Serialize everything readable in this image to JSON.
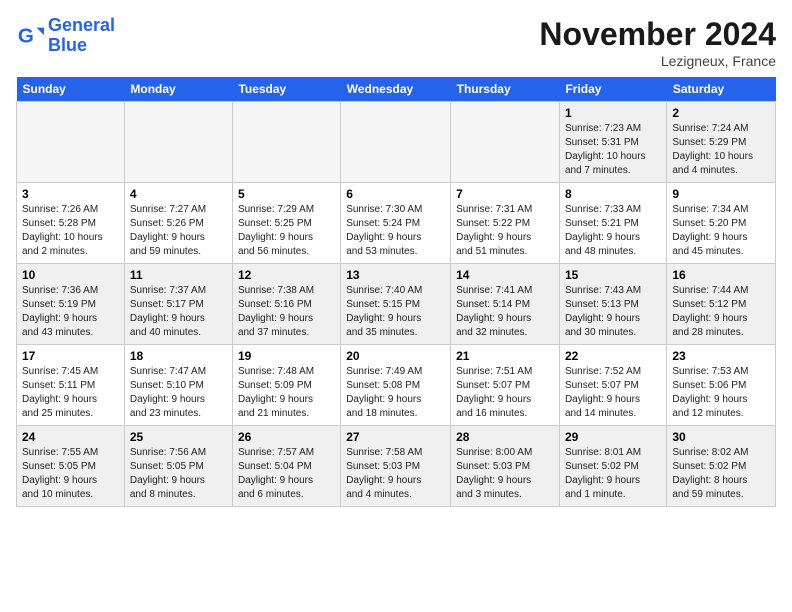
{
  "logo": {
    "line1": "General",
    "line2": "Blue"
  },
  "title": "November 2024",
  "location": "Lezigneux, France",
  "days_of_week": [
    "Sunday",
    "Monday",
    "Tuesday",
    "Wednesday",
    "Thursday",
    "Friday",
    "Saturday"
  ],
  "rows": [
    [
      {
        "num": "",
        "info": "",
        "empty": true
      },
      {
        "num": "",
        "info": "",
        "empty": true
      },
      {
        "num": "",
        "info": "",
        "empty": true
      },
      {
        "num": "",
        "info": "",
        "empty": true
      },
      {
        "num": "",
        "info": "",
        "empty": true
      },
      {
        "num": "1",
        "info": "Sunrise: 7:23 AM\nSunset: 5:31 PM\nDaylight: 10 hours\nand 7 minutes.",
        "empty": false
      },
      {
        "num": "2",
        "info": "Sunrise: 7:24 AM\nSunset: 5:29 PM\nDaylight: 10 hours\nand 4 minutes.",
        "empty": false
      }
    ],
    [
      {
        "num": "3",
        "info": "Sunrise: 7:26 AM\nSunset: 5:28 PM\nDaylight: 10 hours\nand 2 minutes.",
        "empty": false
      },
      {
        "num": "4",
        "info": "Sunrise: 7:27 AM\nSunset: 5:26 PM\nDaylight: 9 hours\nand 59 minutes.",
        "empty": false
      },
      {
        "num": "5",
        "info": "Sunrise: 7:29 AM\nSunset: 5:25 PM\nDaylight: 9 hours\nand 56 minutes.",
        "empty": false
      },
      {
        "num": "6",
        "info": "Sunrise: 7:30 AM\nSunset: 5:24 PM\nDaylight: 9 hours\nand 53 minutes.",
        "empty": false
      },
      {
        "num": "7",
        "info": "Sunrise: 7:31 AM\nSunset: 5:22 PM\nDaylight: 9 hours\nand 51 minutes.",
        "empty": false
      },
      {
        "num": "8",
        "info": "Sunrise: 7:33 AM\nSunset: 5:21 PM\nDaylight: 9 hours\nand 48 minutes.",
        "empty": false
      },
      {
        "num": "9",
        "info": "Sunrise: 7:34 AM\nSunset: 5:20 PM\nDaylight: 9 hours\nand 45 minutes.",
        "empty": false
      }
    ],
    [
      {
        "num": "10",
        "info": "Sunrise: 7:36 AM\nSunset: 5:19 PM\nDaylight: 9 hours\nand 43 minutes.",
        "empty": false
      },
      {
        "num": "11",
        "info": "Sunrise: 7:37 AM\nSunset: 5:17 PM\nDaylight: 9 hours\nand 40 minutes.",
        "empty": false
      },
      {
        "num": "12",
        "info": "Sunrise: 7:38 AM\nSunset: 5:16 PM\nDaylight: 9 hours\nand 37 minutes.",
        "empty": false
      },
      {
        "num": "13",
        "info": "Sunrise: 7:40 AM\nSunset: 5:15 PM\nDaylight: 9 hours\nand 35 minutes.",
        "empty": false
      },
      {
        "num": "14",
        "info": "Sunrise: 7:41 AM\nSunset: 5:14 PM\nDaylight: 9 hours\nand 32 minutes.",
        "empty": false
      },
      {
        "num": "15",
        "info": "Sunrise: 7:43 AM\nSunset: 5:13 PM\nDaylight: 9 hours\nand 30 minutes.",
        "empty": false
      },
      {
        "num": "16",
        "info": "Sunrise: 7:44 AM\nSunset: 5:12 PM\nDaylight: 9 hours\nand 28 minutes.",
        "empty": false
      }
    ],
    [
      {
        "num": "17",
        "info": "Sunrise: 7:45 AM\nSunset: 5:11 PM\nDaylight: 9 hours\nand 25 minutes.",
        "empty": false
      },
      {
        "num": "18",
        "info": "Sunrise: 7:47 AM\nSunset: 5:10 PM\nDaylight: 9 hours\nand 23 minutes.",
        "empty": false
      },
      {
        "num": "19",
        "info": "Sunrise: 7:48 AM\nSunset: 5:09 PM\nDaylight: 9 hours\nand 21 minutes.",
        "empty": false
      },
      {
        "num": "20",
        "info": "Sunrise: 7:49 AM\nSunset: 5:08 PM\nDaylight: 9 hours\nand 18 minutes.",
        "empty": false
      },
      {
        "num": "21",
        "info": "Sunrise: 7:51 AM\nSunset: 5:07 PM\nDaylight: 9 hours\nand 16 minutes.",
        "empty": false
      },
      {
        "num": "22",
        "info": "Sunrise: 7:52 AM\nSunset: 5:07 PM\nDaylight: 9 hours\nand 14 minutes.",
        "empty": false
      },
      {
        "num": "23",
        "info": "Sunrise: 7:53 AM\nSunset: 5:06 PM\nDaylight: 9 hours\nand 12 minutes.",
        "empty": false
      }
    ],
    [
      {
        "num": "24",
        "info": "Sunrise: 7:55 AM\nSunset: 5:05 PM\nDaylight: 9 hours\nand 10 minutes.",
        "empty": false
      },
      {
        "num": "25",
        "info": "Sunrise: 7:56 AM\nSunset: 5:05 PM\nDaylight: 9 hours\nand 8 minutes.",
        "empty": false
      },
      {
        "num": "26",
        "info": "Sunrise: 7:57 AM\nSunset: 5:04 PM\nDaylight: 9 hours\nand 6 minutes.",
        "empty": false
      },
      {
        "num": "27",
        "info": "Sunrise: 7:58 AM\nSunset: 5:03 PM\nDaylight: 9 hours\nand 4 minutes.",
        "empty": false
      },
      {
        "num": "28",
        "info": "Sunrise: 8:00 AM\nSunset: 5:03 PM\nDaylight: 9 hours\nand 3 minutes.",
        "empty": false
      },
      {
        "num": "29",
        "info": "Sunrise: 8:01 AM\nSunset: 5:02 PM\nDaylight: 9 hours\nand 1 minute.",
        "empty": false
      },
      {
        "num": "30",
        "info": "Sunrise: 8:02 AM\nSunset: 5:02 PM\nDaylight: 8 hours\nand 59 minutes.",
        "empty": false
      }
    ]
  ]
}
